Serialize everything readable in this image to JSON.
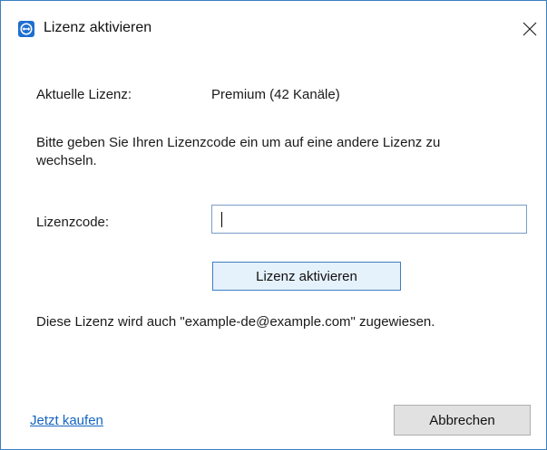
{
  "window": {
    "title": "Lizenz aktivieren",
    "icon": "teamviewer-app-icon",
    "close_icon": "close-icon"
  },
  "license": {
    "current_label": "Aktuelle Lizenz:",
    "current_value": "Premium (42 Kanäle)",
    "instructions": "Bitte geben Sie Ihren Lizenzcode ein um auf eine andere Lizenz zu wechseln.",
    "code_label": "Lizenzcode:",
    "code_value": "",
    "activate_label": "Lizenz aktivieren",
    "assigned_note": "Diese Lizenz wird auch \"example-de@example.com\" zugewiesen."
  },
  "footer": {
    "buy_link": "Jetzt kaufen",
    "cancel_label": "Abbrechen"
  },
  "colors": {
    "accent": "#1e6fd0",
    "link": "#1565c0",
    "focused_border": "#3c7fc1"
  }
}
